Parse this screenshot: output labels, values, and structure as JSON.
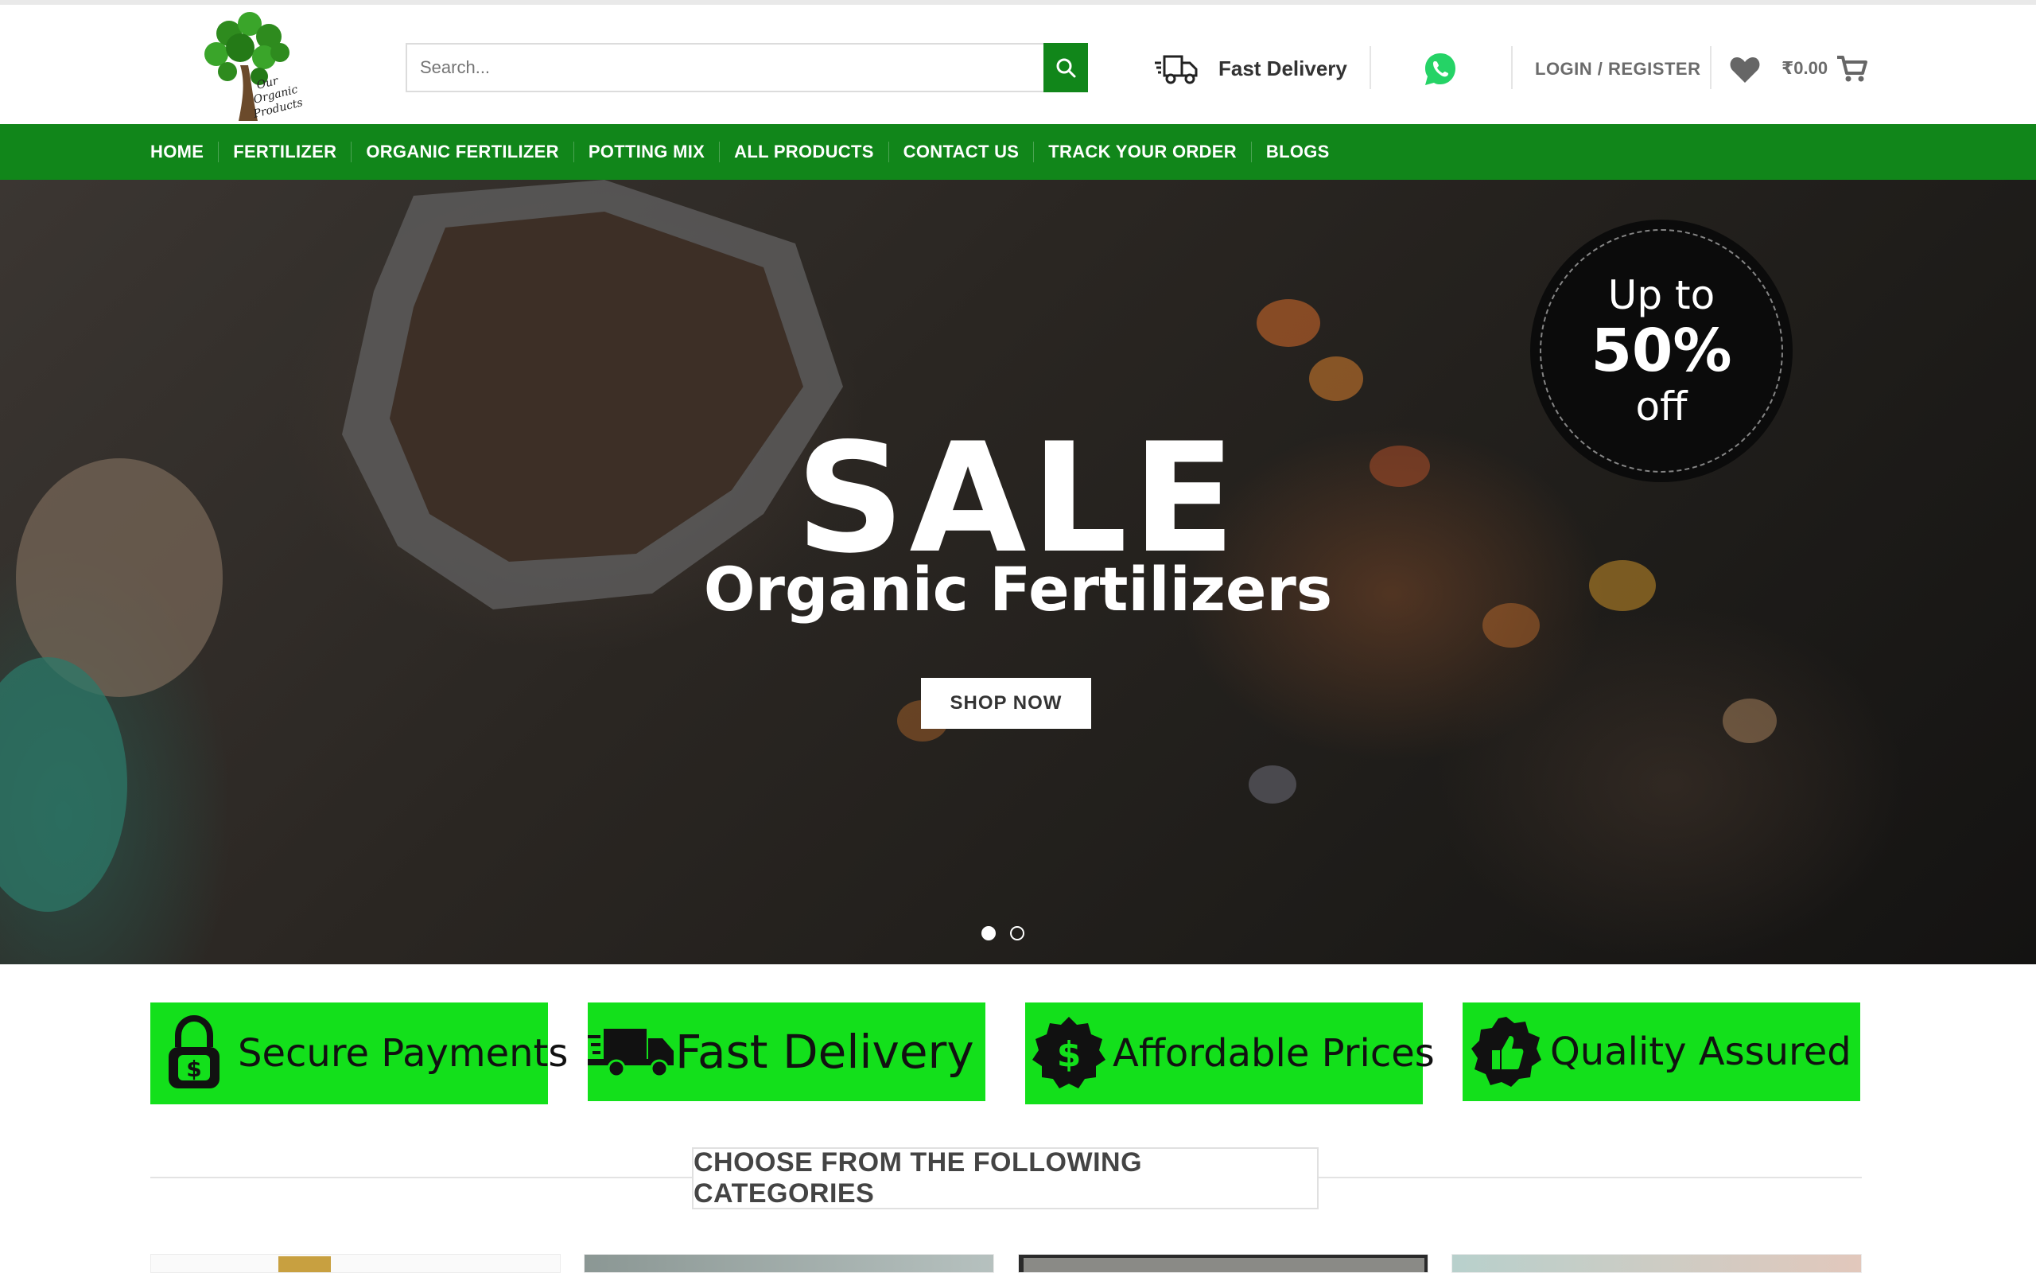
{
  "header": {
    "logo_text": [
      "Our",
      "Organic",
      "Products"
    ],
    "search_placeholder": "Search...",
    "delivery_label": "Fast Delivery",
    "login_label": "LOGIN / REGISTER",
    "cart_total": "₹0.00",
    "icons": {
      "search": "search-icon",
      "truck": "truck-icon",
      "whatsapp": "whatsapp-icon",
      "wishlist": "heart-icon",
      "cart": "cart-icon"
    }
  },
  "nav": {
    "items": [
      "HOME",
      "FERTILIZER",
      "ORGANIC FERTILIZER",
      "POTTING MIX",
      "ALL PRODUCTS",
      "CONTACT US",
      "TRACK YOUR ORDER",
      "BLOGS"
    ]
  },
  "hero": {
    "title": "SALE",
    "subtitle": "Organic Fertilizers",
    "cta": "SHOP NOW",
    "badge": {
      "line1": "Up to",
      "line2": "50%",
      "line3": "off"
    },
    "slides_total": 2,
    "active_slide": 1
  },
  "features": [
    {
      "label": "Secure Payments",
      "icon": "padlock-dollar-icon"
    },
    {
      "label": "Fast Delivery",
      "icon": "truck-icon"
    },
    {
      "label": "Affordable Prices",
      "icon": "dollar-badge-icon"
    },
    {
      "label": "Quality Assured",
      "icon": "thumbs-up-icon"
    }
  ],
  "categories": {
    "heading": "CHOOSE FROM THE FOLLOWING CATEGORIES"
  },
  "colors": {
    "nav_green": "#11861a",
    "feature_green": "#13e01b",
    "badge_black": "#0b0b0b",
    "whatsapp_green": "#25d366"
  }
}
